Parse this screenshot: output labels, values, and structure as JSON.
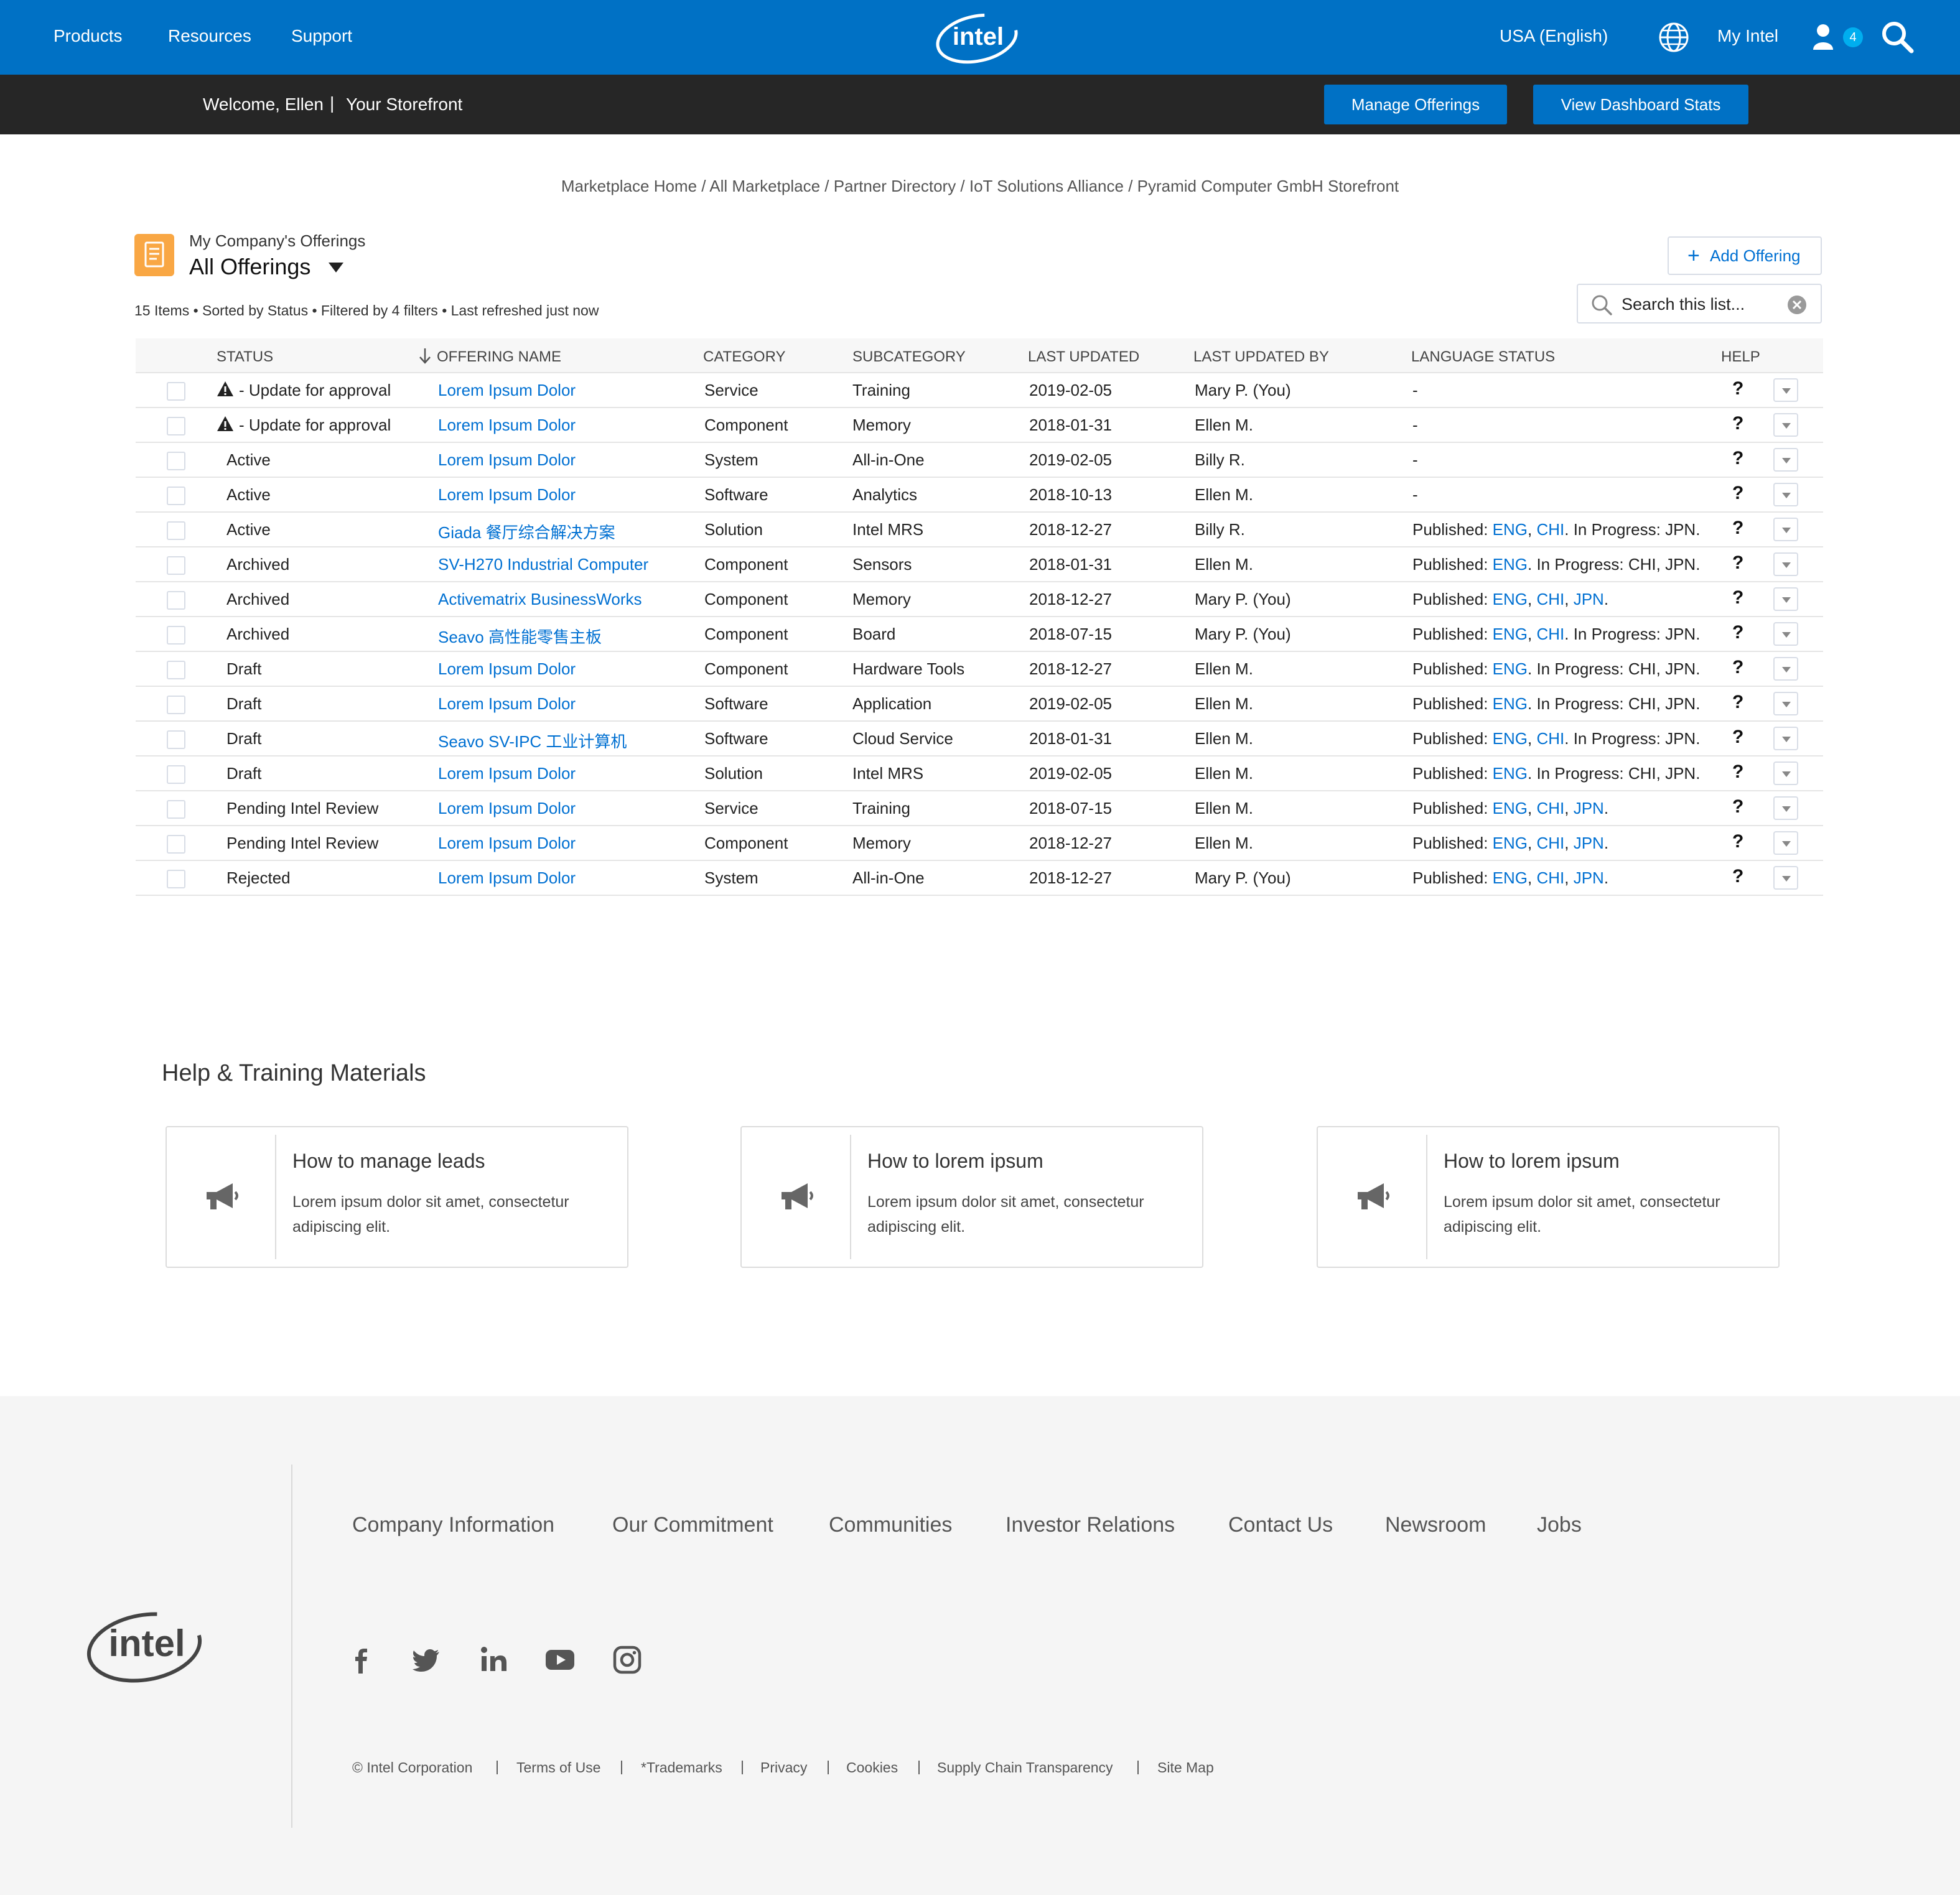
{
  "topnav": {
    "links": [
      "Products",
      "Resources",
      "Support"
    ],
    "logo_text": "intel",
    "region": "USA (English)",
    "my_intel": "My Intel",
    "notification_count": "4",
    "brand_color": "#0071c5"
  },
  "subnav": {
    "welcome": "Welcome, Ellen",
    "separator": "|",
    "storefront": "Your Storefront",
    "manage_offerings": "Manage Offerings",
    "view_dashboard": "View Dashboard Stats"
  },
  "breadcrumb": "Marketplace Home / All Marketplace / Partner Directory / IoT Solutions Alliance / Pyramid Computer GmbH Storefront",
  "list": {
    "kicker": "My Company's Offerings",
    "title": "All Offerings",
    "meta": "15 Items • Sorted by Status • Filtered by 4 filters • Last refreshed just now",
    "add_offering": "Add Offering",
    "search_placeholder": "Search this list...",
    "columns": {
      "status": "Status",
      "name": "Offering Name",
      "category": "Category",
      "subcategory": "Subcategory",
      "updated": "Last Updated",
      "updated_by": "Last Updated By",
      "language": "Language Status",
      "help": "Help"
    },
    "rows": [
      {
        "status": "- Update for approval",
        "warn": true,
        "name": "Lorem Ipsum Dolor",
        "category": "Service",
        "subcategory": "Training",
        "updated": "2019-02-05",
        "by": "Mary P. (You)",
        "lang": {
          "type": "none",
          "text": "-"
        }
      },
      {
        "status": "- Update for approval",
        "warn": true,
        "name": "Lorem Ipsum Dolor",
        "category": "Component",
        "subcategory": "Memory",
        "updated": "2018-01-31",
        "by": "Ellen M.",
        "lang": {
          "type": "none",
          "text": "-"
        }
      },
      {
        "status": "Active",
        "warn": false,
        "name": "Lorem Ipsum Dolor",
        "category": "System",
        "subcategory": "All-in-One",
        "updated": "2019-02-05",
        "by": "Billy R.",
        "lang": {
          "type": "none",
          "text": "-"
        }
      },
      {
        "status": "Active",
        "warn": false,
        "name": "Lorem Ipsum Dolor",
        "category": "Software",
        "subcategory": "Analytics",
        "updated": "2018-10-13",
        "by": "Ellen M.",
        "lang": {
          "type": "none",
          "text": "-"
        }
      },
      {
        "status": "Active",
        "warn": false,
        "name": "Giada 餐厅综合解决方案",
        "category": "Solution",
        "subcategory": "Intel  MRS",
        "updated": "2018-12-27",
        "by": "Billy R.",
        "lang": {
          "type": "partial",
          "published": [
            "ENG",
            "CHI"
          ],
          "progress": "JPN"
        }
      },
      {
        "status": "Archived",
        "warn": false,
        "name": "SV-H270 Industrial Computer",
        "category": "Component",
        "subcategory": "Sensors",
        "updated": "2018-01-31",
        "by": "Ellen M.",
        "lang": {
          "type": "partial",
          "published": [
            "ENG"
          ],
          "progress": "CHI, JPN"
        }
      },
      {
        "status": "Archived",
        "warn": false,
        "name": "Activematrix BusinessWorks",
        "category": "Component",
        "subcategory": "Memory",
        "updated": "2018-12-27",
        "by": "Mary P. (You)",
        "lang": {
          "type": "full",
          "published": [
            "ENG",
            "CHI",
            "JPN"
          ]
        }
      },
      {
        "status": "Archived",
        "warn": false,
        "name": "Seavo 高性能零售主板",
        "category": "Component",
        "subcategory": "Board",
        "updated": "2018-07-15",
        "by": "Mary P. (You)",
        "lang": {
          "type": "partial",
          "published": [
            "ENG",
            "CHI"
          ],
          "progress": "JPN"
        }
      },
      {
        "status": "Draft",
        "warn": false,
        "name": "Lorem Ipsum Dolor",
        "category": "Component",
        "subcategory": "Hardware Tools",
        "updated": "2018-12-27",
        "by": "Ellen M.",
        "lang": {
          "type": "partial",
          "published": [
            "ENG"
          ],
          "progress": "CHI, JPN"
        }
      },
      {
        "status": "Draft",
        "warn": false,
        "name": "Lorem Ipsum Dolor",
        "category": "Software",
        "subcategory": "Application",
        "updated": "2019-02-05",
        "by": "Ellen M.",
        "lang": {
          "type": "partial",
          "published": [
            "ENG"
          ],
          "progress": "CHI, JPN"
        }
      },
      {
        "status": "Draft",
        "warn": false,
        "name": "Seavo SV-IPC 工业计算机",
        "category": "Software",
        "subcategory": "Cloud Service",
        "updated": "2018-01-31",
        "by": "Ellen M.",
        "lang": {
          "type": "partial",
          "published": [
            "ENG",
            "CHI"
          ],
          "progress": "JPN"
        }
      },
      {
        "status": "Draft",
        "warn": false,
        "name": "Lorem Ipsum Dolor",
        "category": "Solution",
        "subcategory": "Intel MRS",
        "updated": "2019-02-05",
        "by": "Ellen M.",
        "lang": {
          "type": "partial",
          "published": [
            "ENG"
          ],
          "progress": "CHI, JPN"
        }
      },
      {
        "status": "Pending Intel Review",
        "warn": false,
        "name": "Lorem Ipsum Dolor",
        "category": "Service",
        "subcategory": "Training",
        "updated": "2018-07-15",
        "by": "Ellen M.",
        "lang": {
          "type": "full",
          "published": [
            "ENG",
            "CHI",
            "JPN"
          ]
        }
      },
      {
        "status": "Pending Intel Review",
        "warn": false,
        "name": "Lorem Ipsum Dolor",
        "category": "Component",
        "subcategory": "Memory",
        "updated": "2018-12-27",
        "by": "Ellen M.",
        "lang": {
          "type": "full",
          "published": [
            "ENG",
            "CHI",
            "JPN"
          ]
        }
      },
      {
        "status": "Rejected",
        "warn": false,
        "name": "Lorem Ipsum Dolor",
        "category": "System",
        "subcategory": "All-in-One",
        "updated": "2018-12-27",
        "by": "Mary P. (You)",
        "lang": {
          "type": "full",
          "published": [
            "ENG",
            "CHI",
            "JPN"
          ]
        }
      }
    ],
    "lang_labels": {
      "published": "Published: ",
      "in_progress": " In Progress: "
    },
    "help_glyph": "?"
  },
  "help": {
    "title": "Help & Training Materials",
    "cards": [
      {
        "title": "How to manage leads",
        "desc": "Lorem ipsum dolor sit amet, consectetur adipiscing elit."
      },
      {
        "title": "How to lorem ipsum",
        "desc": "Lorem ipsum dolor sit amet, consectetur adipiscing elit."
      },
      {
        "title": "How to lorem ipsum",
        "desc": "Lorem ipsum dolor sit amet, consectetur adipiscing elit."
      }
    ]
  },
  "footer": {
    "nav": [
      "Company Information",
      "Our Commitment",
      "Communities",
      "Investor Relations",
      "Contact Us",
      "Newsroom",
      "Jobs"
    ],
    "social": [
      "facebook-icon",
      "twitter-icon",
      "linkedin-icon",
      "youtube-icon",
      "instagram-icon"
    ],
    "legal": [
      "© Intel Corporation",
      "Terms of Use",
      "*Trademarks",
      "Privacy",
      "Cookies",
      "Supply Chain Transparency",
      "Site Map"
    ],
    "legal_separator": "|"
  }
}
